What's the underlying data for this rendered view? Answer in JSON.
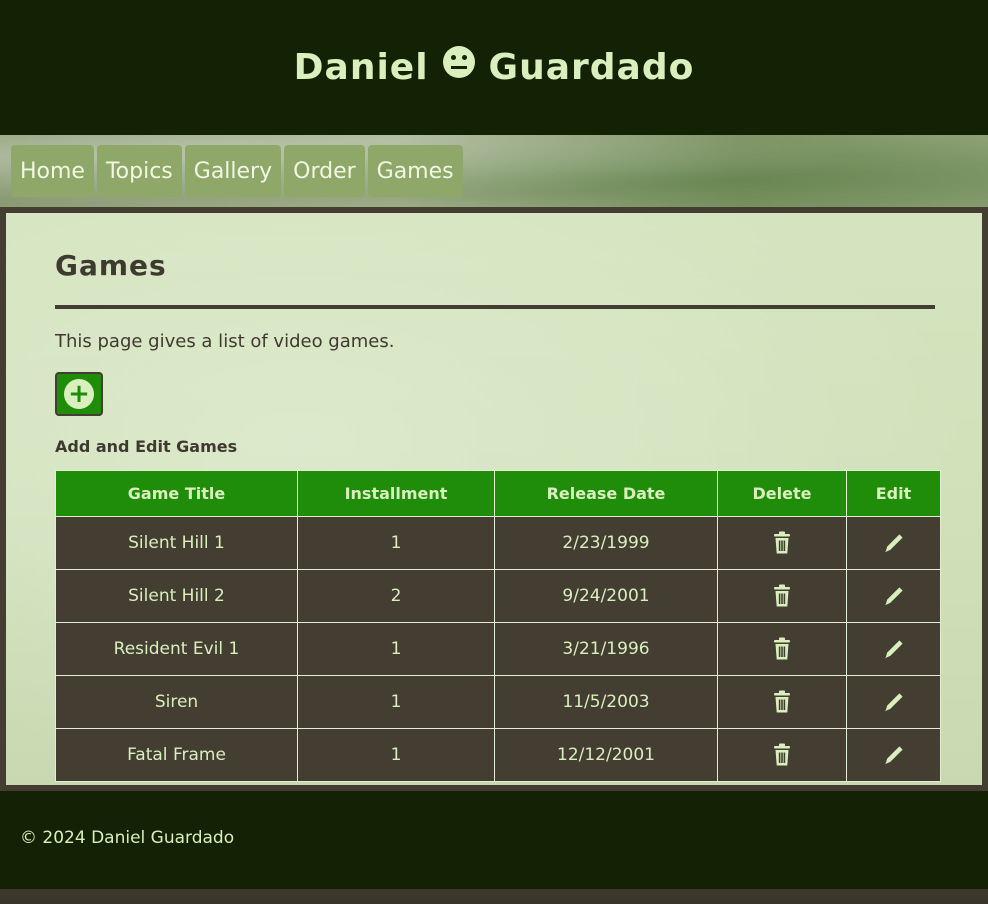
{
  "header": {
    "name_first": "Daniel",
    "name_last": "Guardado",
    "icon": "neutral-face-icon"
  },
  "nav": {
    "items": [
      {
        "label": "Home"
      },
      {
        "label": "Topics"
      },
      {
        "label": "Gallery"
      },
      {
        "label": "Order"
      },
      {
        "label": "Games"
      }
    ]
  },
  "main": {
    "title": "Games",
    "intro": "This page gives a list of video games.",
    "add_button_icon": "plus-circle-icon",
    "section_label": "Add and Edit Games"
  },
  "table": {
    "headers": {
      "title": "Game Title",
      "installment": "Installment",
      "release_date": "Release Date",
      "delete": "Delete",
      "edit": "Edit"
    },
    "rows": [
      {
        "title": "Silent Hill 1",
        "installment": "1",
        "release_date": "2/23/1999"
      },
      {
        "title": "Silent Hill 2",
        "installment": "2",
        "release_date": "9/24/2001"
      },
      {
        "title": "Resident Evil 1",
        "installment": "1",
        "release_date": "3/21/1996"
      },
      {
        "title": "Siren",
        "installment": "1",
        "release_date": "11/5/2003"
      },
      {
        "title": "Fatal Frame",
        "installment": "1",
        "release_date": "12/12/2001"
      }
    ],
    "delete_icon": "trash-icon",
    "edit_icon": "pencil-icon"
  },
  "footer": {
    "copyright": "© 2024 Daniel Guardado"
  },
  "colors": {
    "header_bg": "#132204",
    "accent_green": "#1f8d09",
    "row_bg": "#443d31",
    "text_light": "#d9efbe"
  }
}
